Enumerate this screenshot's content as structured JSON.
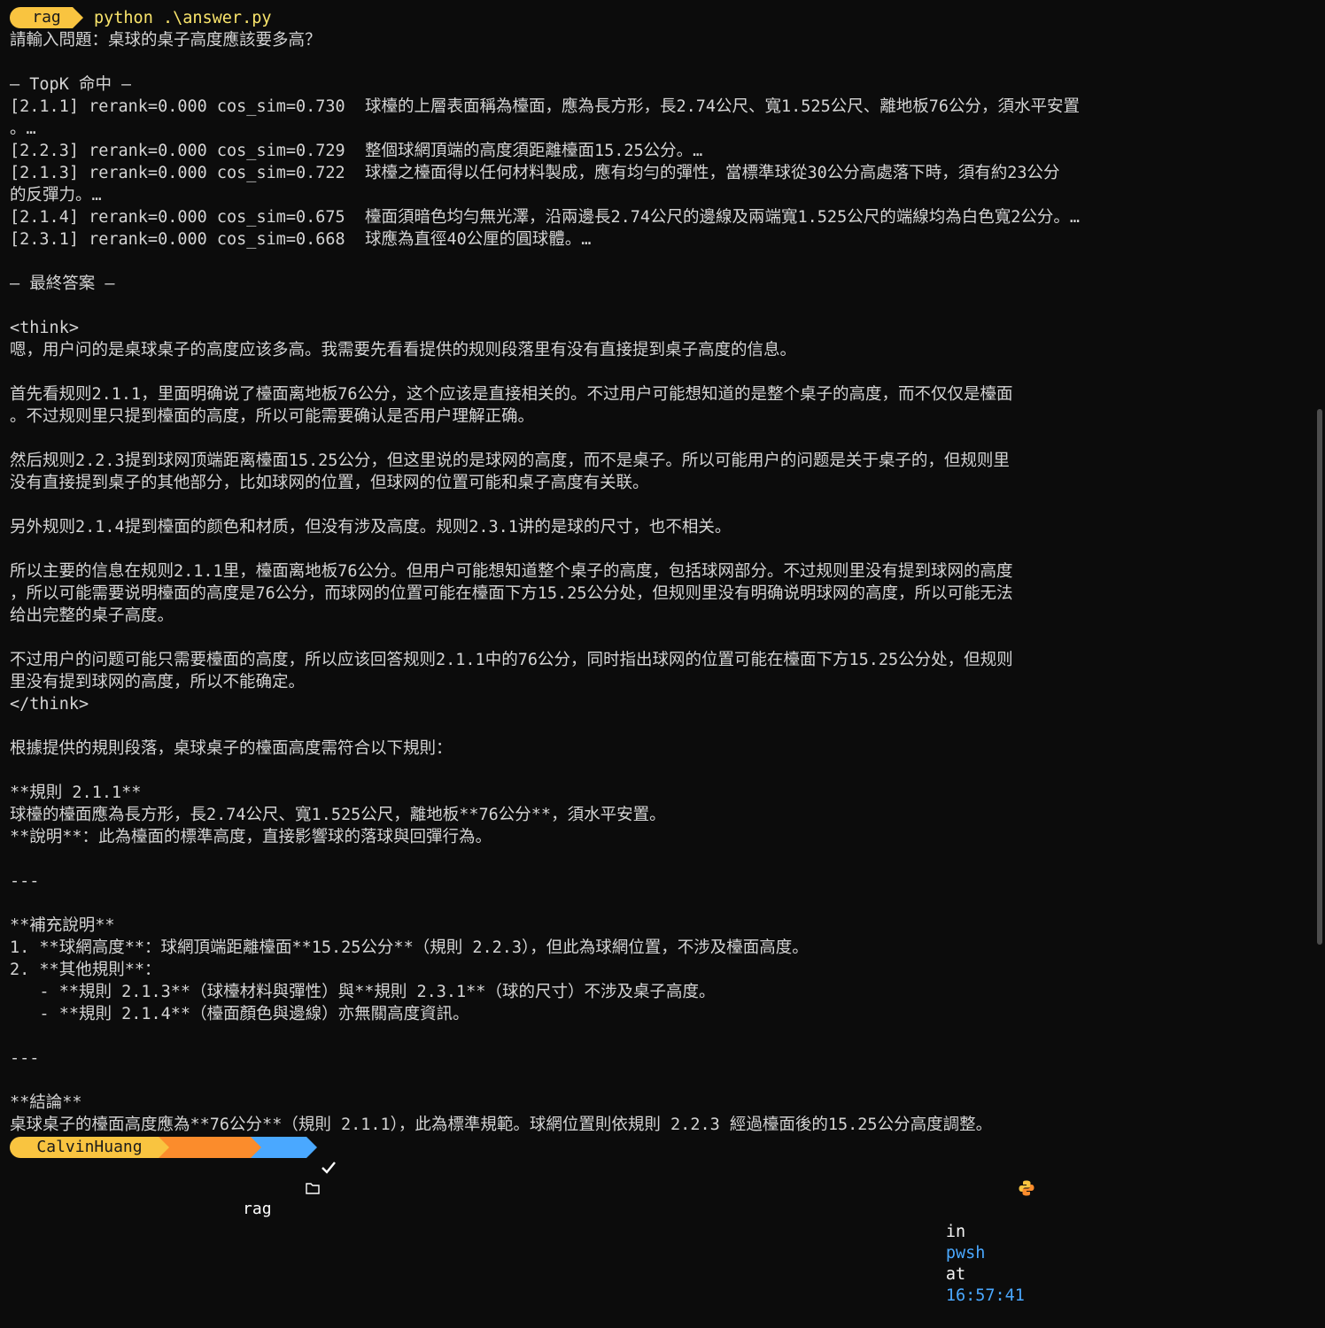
{
  "prompt_top": {
    "env": "rag",
    "command": "python .\\answer.py"
  },
  "lines": [
    "請輸入問題：桌球的桌子高度應該要多高？",
    "",
    "— TopK 命中 —",
    "[2.1.1] rerank=0.000 cos_sim=0.730  球檯的上層表面稱為檯面，應為長方形，長2.74公尺、寬1.525公尺、離地板76公分，須水平安置",
    "。…",
    "[2.2.3] rerank=0.000 cos_sim=0.729  整個球網頂端的高度須距離檯面15.25公分。…",
    "[2.1.3] rerank=0.000 cos_sim=0.722  球檯之檯面得以任何材料製成，應有均勻的彈性，當標準球從30公分高處落下時，須有約23公分",
    "的反彈力。…",
    "[2.1.4] rerank=0.000 cos_sim=0.675  檯面須暗色均勻無光澤，沿兩邊長2.74公尺的邊線及兩端寬1.525公尺的端線均為白色寬2公分。…",
    "[2.3.1] rerank=0.000 cos_sim=0.668  球應為直徑40公厘的圓球體。…",
    "",
    "— 最終答案 —",
    "",
    "<think>",
    "嗯，用户问的是桌球桌子的高度应该多高。我需要先看看提供的规则段落里有没有直接提到桌子高度的信息。",
    "",
    "首先看规则2.1.1，里面明确说了檯面离地板76公分，这个应该是直接相关的。不过用户可能想知道的是整个桌子的高度，而不仅仅是檯面",
    "。不过规则里只提到檯面的高度，所以可能需要确认是否用户理解正确。",
    "",
    "然后规则2.2.3提到球网顶端距离檯面15.25公分，但这里说的是球网的高度，而不是桌子。所以可能用户的问题是关于桌子的，但规则里",
    "没有直接提到桌子的其他部分，比如球网的位置，但球网的位置可能和桌子高度有关联。",
    "",
    "另外规则2.1.4提到檯面的颜色和材质，但没有涉及高度。规则2.3.1讲的是球的尺寸，也不相关。",
    "",
    "所以主要的信息在规则2.1.1里，檯面离地板76公分。但用户可能想知道整个桌子的高度，包括球网部分。不过规则里没有提到球网的高度",
    "，所以可能需要说明檯面的高度是76公分，而球网的位置可能在檯面下方15.25公分处，但规则里没有明确说明球网的高度，所以可能无法",
    "给出完整的桌子高度。",
    "",
    "不过用户的问题可能只需要檯面的高度，所以应该回答规则2.1.1中的76公分，同时指出球网的位置可能在檯面下方15.25公分处，但规则",
    "里没有提到球网的高度，所以不能确定。",
    "</think>",
    "",
    "根據提供的規則段落，桌球桌子的檯面高度需符合以下規則：",
    "",
    "**規則 2.1.1**",
    "球檯的檯面應為長方形，長2.74公尺、寬1.525公尺，離地板**76公分**，須水平安置。",
    "**說明**：此為檯面的標準高度，直接影響球的落球與回彈行為。",
    "",
    "---",
    "",
    "**補充說明**",
    "1. **球網高度**：球網頂端距離檯面**15.25公分**（規則 2.2.3），但此為球網位置，不涉及檯面高度。",
    "2. **其他規則**：",
    "   - **規則 2.1.3**（球檯材料與彈性）與**規則 2.3.1**（球的尺寸）不涉及桌子高度。",
    "   - **規則 2.1.4**（檯面顏色與邊線）亦無關高度資訊。",
    "",
    "---",
    "",
    "**結論**",
    "桌球桌子的檯面高度應為**76公分**（規則 2.1.1），此為標準規範。球網位置則依規則 2.2.3 經過檯面後的15.25公分高度調整。"
  ],
  "prompt_bottom": {
    "user": "CalvinHuang",
    "env": "rag",
    "status_icon": "check-icon",
    "folder_icon": "folder-icon",
    "python_icon": "python-icon",
    "in_label": "in",
    "shell": "pwsh",
    "at_label": "at",
    "time": "16:57:41"
  },
  "colors": {
    "background": "#0c0c0c",
    "text": "#d4d4d4",
    "prompt_yellow": "#f9c440",
    "prompt_orange": "#fb8c2c",
    "prompt_blue": "#4aa8ff"
  }
}
